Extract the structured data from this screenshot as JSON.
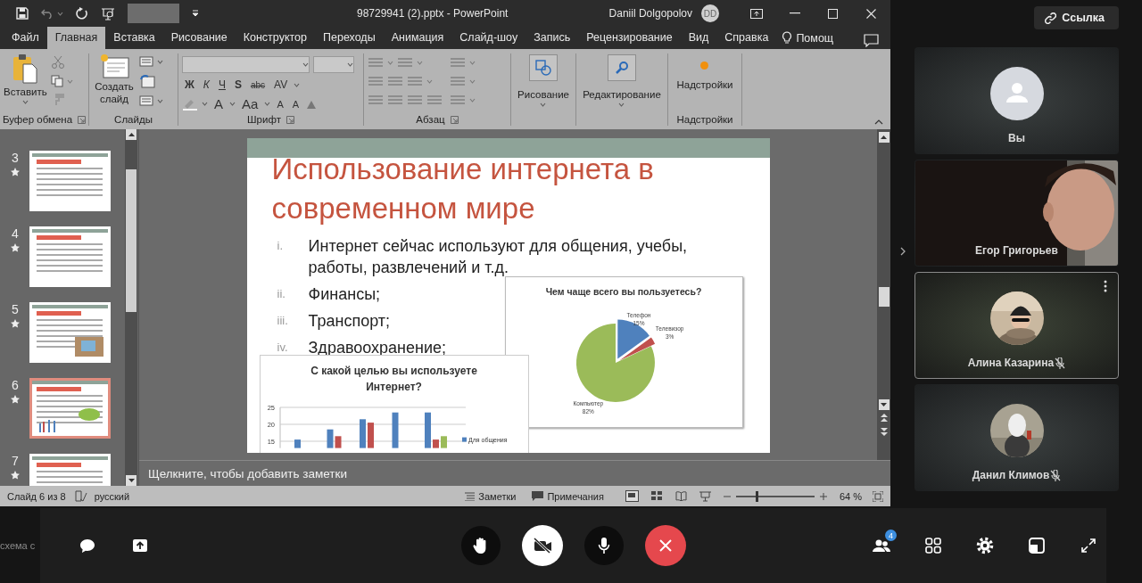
{
  "powerpoint": {
    "title": "98729941 (2).pptx  -  PowerPoint",
    "user": "Daniil Dolgopolov",
    "initials": "DD",
    "tabs": [
      {
        "label": "Файл",
        "selected": false
      },
      {
        "label": "Главная",
        "selected": true
      },
      {
        "label": "Вставка",
        "selected": false
      },
      {
        "label": "Рисование",
        "selected": false
      },
      {
        "label": "Конструктор",
        "selected": false
      },
      {
        "label": "Переходы",
        "selected": false
      },
      {
        "label": "Анимация",
        "selected": false
      },
      {
        "label": "Слайд-шоу",
        "selected": false
      },
      {
        "label": "Запись",
        "selected": false
      },
      {
        "label": "Рецензирование",
        "selected": false
      },
      {
        "label": "Вид",
        "selected": false
      },
      {
        "label": "Справка",
        "selected": false
      }
    ],
    "help": "Помощ",
    "ribbon": [
      {
        "kind": "clipboard",
        "label": "Буфер обмена",
        "button": "Вставить"
      },
      {
        "kind": "slides",
        "label": "Слайды",
        "button": "Создать слайд"
      },
      {
        "kind": "font",
        "label": "Шрифт",
        "row1": [
          "Ж",
          "К",
          "Ч",
          "S",
          "abc",
          "AV"
        ],
        "row2": [
          "A",
          "Aa",
          "A",
          "A"
        ]
      },
      {
        "kind": "paragraph",
        "label": "Абзац"
      },
      {
        "kind": "drawing",
        "button": "Рисование"
      },
      {
        "kind": "editing",
        "button": "Редактирование"
      },
      {
        "kind": "addins",
        "button": "Надстройки",
        "label": "Надстройки"
      }
    ],
    "thumbnails": [
      {
        "number": "3",
        "selected": false
      },
      {
        "number": "4",
        "selected": false
      },
      {
        "number": "5",
        "selected": false
      },
      {
        "number": "6",
        "selected": true
      },
      {
        "number": "7",
        "selected": false
      }
    ],
    "slide": {
      "title": "Использование интернета в современном мире",
      "items": [
        {
          "marker": "i.",
          "text": "Интернет сейчас используют для общения, учебы, работы, развлечений и т.д."
        },
        {
          "marker": "ii.",
          "text": "Финансы;"
        },
        {
          "marker": "iii.",
          "text": "Транспорт;"
        },
        {
          "marker": "iv.",
          "text": "Здравоохранение;"
        }
      ],
      "pie": {
        "chart_data": {
          "type": "pie",
          "title": "Чем чаще всего вы пользуетесь?",
          "categories": [
            "Телефон",
            "Телевизор",
            "Компьютер"
          ],
          "values": [
            15,
            3,
            82
          ],
          "value_labels": [
            "15%",
            "3%",
            "82%"
          ]
        }
      },
      "bars": {
        "chart_data": {
          "type": "bar",
          "title": "С какой целью вы используете Интернет?",
          "ylim": [
            13,
            25
          ],
          "grid": true,
          "yticks": [
            15,
            20,
            25
          ],
          "series": [
            {
              "name": "Для общения",
              "color": "#4f81bd",
              "values": [
                15.5,
                18.5,
                21.5,
                23.5,
                23.5
              ]
            },
            {
              "color": "#c0504d",
              "values": [
                null,
                16.5,
                20.5,
                null,
                15.5
              ]
            },
            {
              "color": "#9bbb59",
              "values": [
                null,
                null,
                null,
                null,
                16.5
              ]
            }
          ]
        }
      }
    },
    "notes_placeholder": "Щелкните, чтобы добавить заметки",
    "status": {
      "slide": "Слайд 6 из 8",
      "language": "русский",
      "notes": "Заметки",
      "comments": "Примечания",
      "zoom": "64 %",
      "level": 0.25
    }
  },
  "side_text": "схема с",
  "link_button": "Ссылка",
  "participants": [
    {
      "name": "Вы",
      "kind": "avatar",
      "muted": false,
      "selected": false
    },
    {
      "name": "Егор Григорьев",
      "kind": "video",
      "muted": false,
      "selected": false
    },
    {
      "name": "Алина Казарина",
      "muted": true,
      "selected": true
    },
    {
      "name": "Данил Климов",
      "muted": true,
      "selected": false
    }
  ],
  "participant_count": "4"
}
